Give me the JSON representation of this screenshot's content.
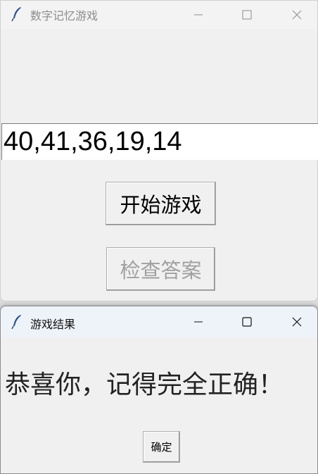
{
  "main_window": {
    "title": "数字记忆游戏",
    "number_display": "40,41,36,19,14",
    "start_button": "开始游戏",
    "check_button": "检查答案"
  },
  "dialog": {
    "title": "游戏结果",
    "message": "恭喜你，记得完全正确！",
    "ok_button": "确定"
  },
  "colors": {
    "window_bg": "#f0f0f0",
    "entry_bg": "#ffffff",
    "disabled_text": "#a0a0a0",
    "dialog_titlebar": "#eef3fa"
  },
  "icons": {
    "app_icon": "feather-icon",
    "minimize": "minimize-icon",
    "maximize": "maximize-icon",
    "close": "close-icon"
  }
}
